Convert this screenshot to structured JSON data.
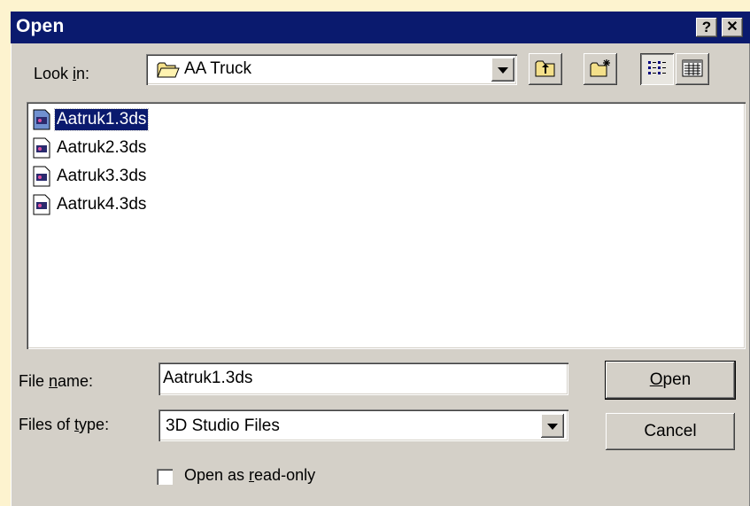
{
  "dialog": {
    "title": "Open",
    "help_button": "?",
    "close_button": "✕"
  },
  "look_in": {
    "label_pre": "Look ",
    "label_key": "i",
    "label_post": "n:",
    "value": "AA Truck",
    "icon": "folder-icon"
  },
  "toolbar": {
    "up_folder_icon": "up-one-level-icon",
    "new_folder_icon": "new-folder-icon",
    "list_view_icon": "list-view-icon",
    "details_view_icon": "details-view-icon"
  },
  "files": [
    {
      "name": "Aatruk1.3ds",
      "selected": true
    },
    {
      "name": "Aatruk2.3ds",
      "selected": false
    },
    {
      "name": "Aatruk3.3ds",
      "selected": false
    },
    {
      "name": "Aatruk4.3ds",
      "selected": false
    }
  ],
  "file_name": {
    "label_pre": "File ",
    "label_key": "n",
    "label_post": "ame:",
    "value": "Aatruk1.3ds"
  },
  "file_type": {
    "label_pre": "Files of ",
    "label_key": "t",
    "label_post": "ype:",
    "value": "3D Studio Files"
  },
  "read_only": {
    "label_pre": "Open as ",
    "label_key": "r",
    "label_post": "ead-only",
    "checked": false
  },
  "buttons": {
    "open_key": "O",
    "open_post": "pen",
    "cancel": "Cancel"
  },
  "colors": {
    "title_bar": "#0a1a6e",
    "dialog_face": "#d4d0c8",
    "selection": "#0a1a6e",
    "backdrop": "#fdf3cf"
  }
}
